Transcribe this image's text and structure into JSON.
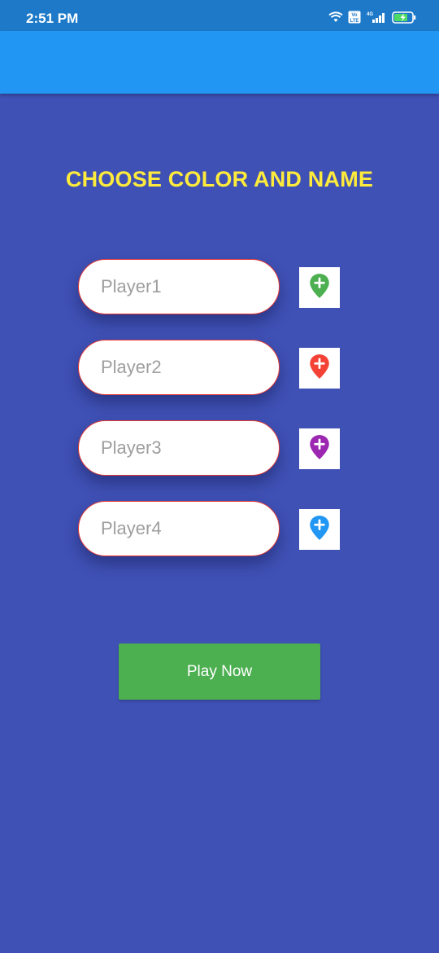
{
  "status_bar": {
    "time": "2:51 PM",
    "network": "4G",
    "volte": "Vo LTE"
  },
  "title": "CHOOSE COLOR AND NAME",
  "players": [
    {
      "placeholder": "Player1",
      "value": "",
      "color": "#4CAF50",
      "icon": "add-location-icon"
    },
    {
      "placeholder": "Player2",
      "value": "",
      "color": "#F44336",
      "icon": "add-location-icon"
    },
    {
      "placeholder": "Player3",
      "value": "",
      "color": "#9C27B0",
      "icon": "add-location-icon"
    },
    {
      "placeholder": "Player4",
      "value": "",
      "color": "#2196F3",
      "icon": "add-location-icon"
    }
  ],
  "play_button_label": "Play Now",
  "colors": {
    "background": "#3F51B5",
    "app_bar": "#2196F3",
    "status_bar": "#1E7AC8",
    "title": "#FFEB3B",
    "play_button": "#4CAF50",
    "input_border": "#E53935"
  }
}
